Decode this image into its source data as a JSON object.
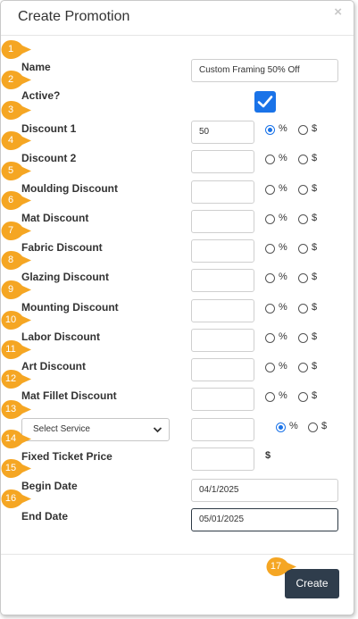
{
  "dialog": {
    "title": "Create Promotion",
    "close_glyph": "×",
    "create_label": "Create"
  },
  "fields": {
    "name_label": "Name",
    "name_value": "Custom Framing 50% Off",
    "active_label": "Active?",
    "active_checked": true,
    "discounts": [
      {
        "label": "Discount 1",
        "value": "50",
        "selected": "%"
      },
      {
        "label": "Discount 2",
        "value": "",
        "selected": ""
      },
      {
        "label": "Moulding Discount",
        "value": "",
        "selected": ""
      },
      {
        "label": "Mat Discount",
        "value": "",
        "selected": ""
      },
      {
        "label": "Fabric Discount",
        "value": "",
        "selected": ""
      },
      {
        "label": "Glazing Discount",
        "value": "",
        "selected": ""
      },
      {
        "label": "Mounting Discount",
        "value": "",
        "selected": ""
      },
      {
        "label": "Labor Discount",
        "value": "",
        "selected": ""
      },
      {
        "label": "Art Discount",
        "value": "",
        "selected": ""
      },
      {
        "label": "Mat Fillet Discount",
        "value": "",
        "selected": ""
      }
    ],
    "service_select": {
      "value": "Select Service",
      "amount": "",
      "selected": "%"
    },
    "fixed_ticket_label": "Fixed Ticket Price",
    "fixed_ticket_value": "",
    "fixed_ticket_unit": "$",
    "begin_date_label": "Begin Date",
    "begin_date_value": "04/1/2025",
    "end_date_label": "End Date",
    "end_date_value": "05/01/2025",
    "percent_label": "%",
    "dollar_label": "$"
  },
  "markers": [
    "1",
    "2",
    "3",
    "4",
    "5",
    "6",
    "7",
    "8",
    "9",
    "10",
    "11",
    "12",
    "13",
    "14",
    "15",
    "16",
    "17"
  ],
  "colors": {
    "marker": "#f5a623",
    "accent": "#1a73e8",
    "button": "#2f3d4c"
  }
}
